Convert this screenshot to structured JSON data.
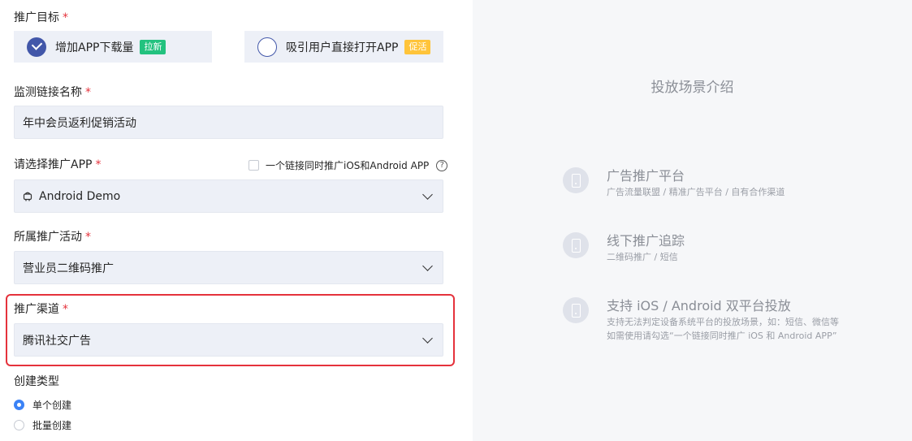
{
  "form": {
    "goal_label": "推广目标",
    "goal_options": [
      {
        "label": "增加APP下载量",
        "tag": "拉新",
        "checked": true
      },
      {
        "label": "吸引用户直接打开APP",
        "tag": "促活",
        "checked": false
      }
    ],
    "link_name_label": "监测链接名称",
    "link_name_value": "年中会员返利促销活动",
    "app_label": "请选择推广APP",
    "dual_platform_checkbox_label": "一个链接同时推广iOS和Android APP",
    "help_glyph": "?",
    "app_value": "Android Demo",
    "activity_label": "所属推广活动",
    "activity_value": "营业员二维码推广",
    "channel_label": "推广渠道",
    "channel_value": "腾讯社交广告",
    "create_type_label": "创建类型",
    "create_type_options": [
      {
        "label": "单个创建",
        "selected": true
      },
      {
        "label": "批量创建",
        "selected": false
      }
    ],
    "required_mark": "*"
  },
  "panel": {
    "title": "投放场景介绍",
    "items": [
      {
        "title": "广告推广平台",
        "desc": [
          "广告流量联盟 / 精准广告平台 / 自有合作渠道"
        ]
      },
      {
        "title": "线下推广追踪",
        "desc": [
          "二维码推广 / 短信"
        ]
      },
      {
        "title": "支持 iOS / Android 双平台投放",
        "desc": [
          "支持无法判定设备系统平台的投放场景，如：短信、微信等",
          "如需使用请勾选“一个链接同时推广 iOS 和 Android APP”"
        ]
      }
    ]
  },
  "colors": {
    "accent": "#4257a9",
    "required": "#e5323c",
    "tag_new": "#23c27f",
    "tag_active": "#ffc43a",
    "radio_selected": "#3b82f6"
  },
  "icons": [
    "checkmark-icon",
    "android-icon",
    "chevron-down-icon",
    "help-icon",
    "phone-icon"
  ]
}
